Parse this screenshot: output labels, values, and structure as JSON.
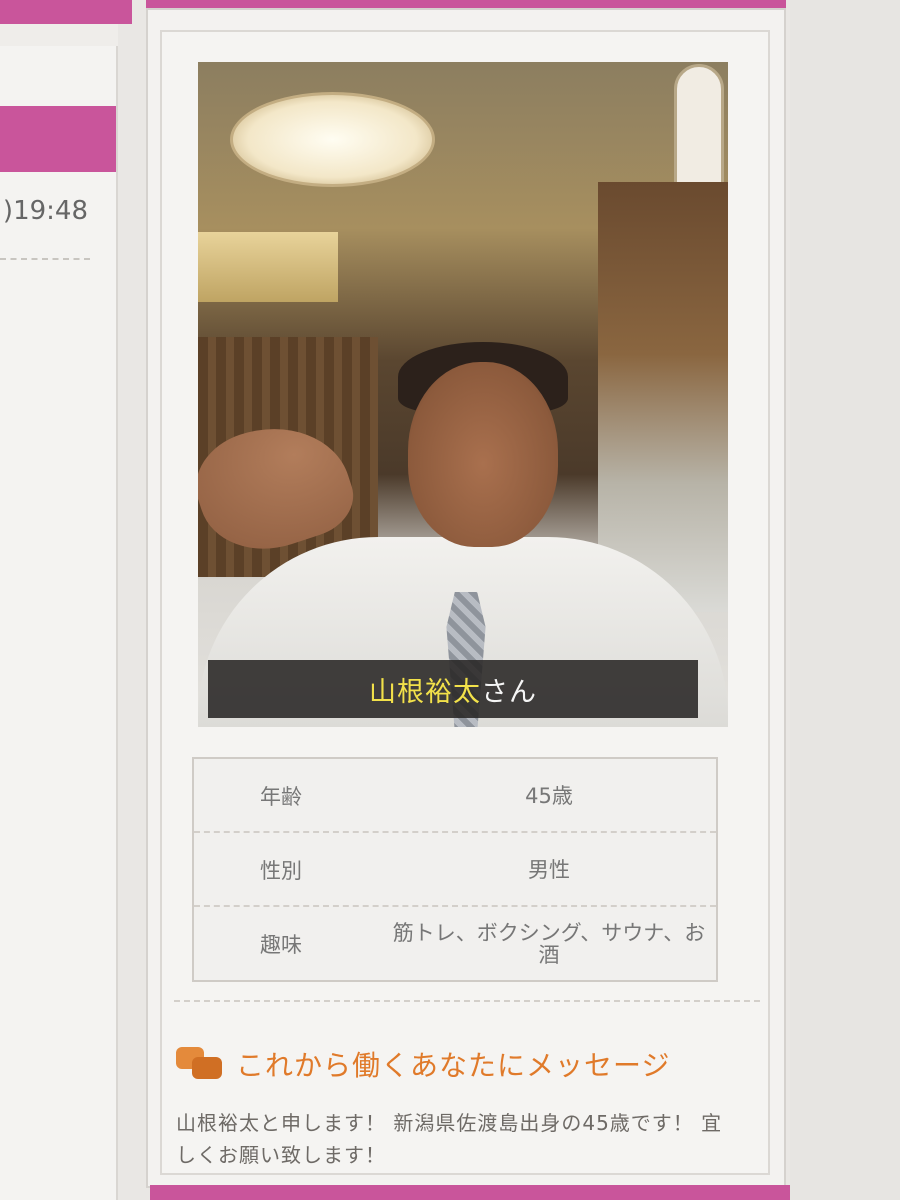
{
  "left": {
    "time_fragment": ")19:48"
  },
  "profile": {
    "name_yellow": "山根裕太",
    "name_suffix": "さん",
    "rows": [
      {
        "label": "年齢",
        "value": "45歳"
      },
      {
        "label": "性別",
        "value": "男性"
      },
      {
        "label": "趣味",
        "value": "筋トレ、ボクシング、サウナ、お酒"
      }
    ]
  },
  "message": {
    "heading": "これから働くあなたにメッセージ",
    "body": "山根裕太と申します！ 新潟県佐渡島出身の45歳です！ 宜しくお願い致します！",
    "icon": "speech-bubbles-icon"
  },
  "colors": {
    "brand_pink": "#c9559b",
    "accent_orange": "#e07a2a",
    "name_yellow": "#f2e14a"
  }
}
